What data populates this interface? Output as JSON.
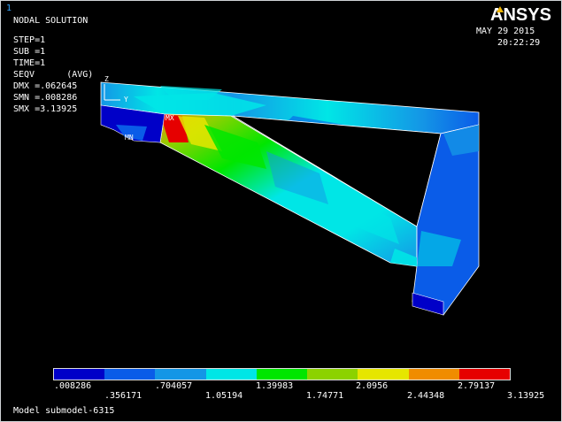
{
  "window_number": "1",
  "title": "NODAL SOLUTION",
  "info_lines": {
    "step": "STEP=1",
    "sub": "SUB =1",
    "time": "TIME=1",
    "result": "SEQV      (AVG)",
    "dmx": "DMX =.062645",
    "smn": "SMN =.008286",
    "smx": "SMX =3.13925"
  },
  "date": "MAY 29 2015",
  "time": "20:22:29",
  "brand": "ANSYS",
  "markers": {
    "min": "MN",
    "max": "MX",
    "axis_y": "Y",
    "axis_z": "Z"
  },
  "legend": {
    "colors": [
      "#0000c8",
      "#0a5ce8",
      "#1496e6",
      "#00e6e6",
      "#00e600",
      "#8cd200",
      "#e6e600",
      "#f08c00",
      "#e60000"
    ],
    "top_values": [
      ".008286",
      ".704057",
      "1.39983",
      "2.0956",
      "2.79137"
    ],
    "bottom_values": [
      ".356171",
      "1.05194",
      "1.74771",
      "2.44348",
      "3.13925"
    ]
  },
  "model_label": "Model submodel-6315"
}
